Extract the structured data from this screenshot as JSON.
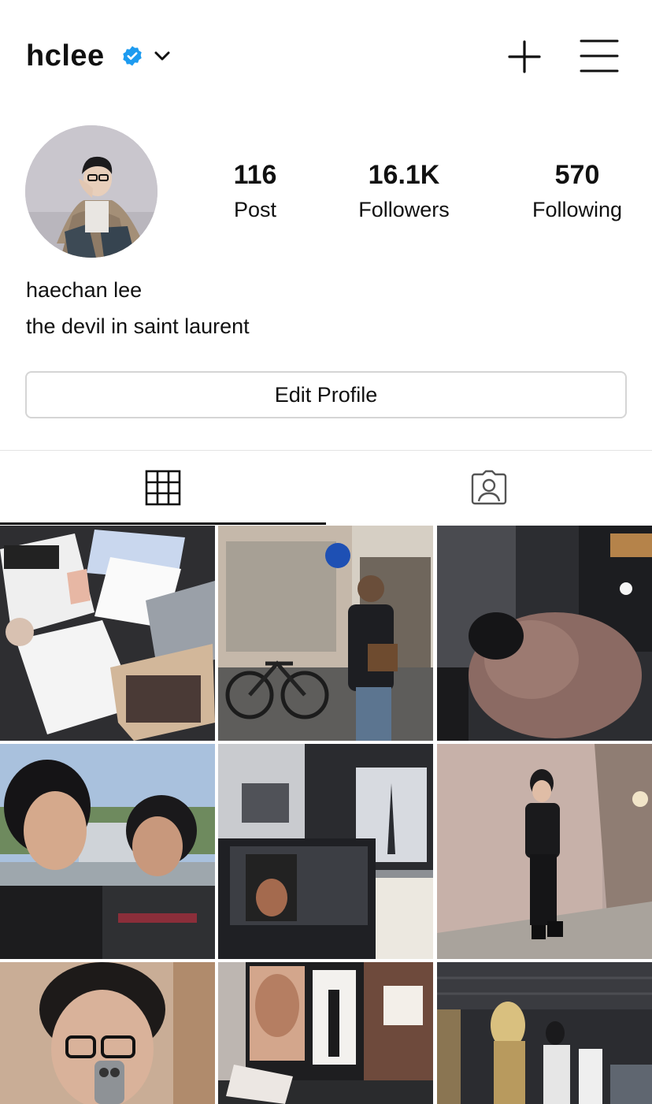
{
  "header": {
    "username": "hclee",
    "verified_icon": "verified-badge-icon",
    "dropdown_icon": "chevron-down-icon",
    "new_post_icon": "plus-icon",
    "menu_icon": "hamburger-menu-icon",
    "accent_color": "#1d9bf0"
  },
  "profile": {
    "full_name": "haechan lee",
    "bio": "the devil in saint laurent",
    "stats": {
      "posts_count": "116",
      "posts_label": "Post",
      "followers_count": "16.1K",
      "followers_label": "Followers",
      "following_count": "570",
      "following_label": "Following"
    },
    "edit_button_label": "Edit Profile"
  },
  "tabs": [
    {
      "icon": "grid-icon",
      "selected": true
    },
    {
      "icon": "tagged-person-icon",
      "selected": false
    }
  ],
  "posts": [
    {
      "kind": "photo",
      "colors": [
        "#d7d8dc",
        "#3a3a3c"
      ]
    },
    {
      "kind": "photo",
      "colors": [
        "#9aa3a8",
        "#5b5048"
      ]
    },
    {
      "kind": "photo",
      "colors": [
        "#3b3d42",
        "#8a6b62"
      ]
    },
    {
      "kind": "photo",
      "colors": [
        "#8ea4bf",
        "#2a2a2c"
      ]
    },
    {
      "kind": "photo",
      "colors": [
        "#3d3f44",
        "#cdd0d6"
      ]
    },
    {
      "kind": "photo",
      "colors": [
        "#b7a39c",
        "#1d1b1c"
      ]
    },
    {
      "kind": "photo",
      "colors": [
        "#b89a85",
        "#2a2622"
      ]
    },
    {
      "kind": "photo",
      "colors": [
        "#ddd6d2",
        "#6e4a3e"
      ]
    },
    {
      "kind": "photo",
      "colors": [
        "#2a2b2f",
        "#b89a6c"
      ]
    }
  ]
}
